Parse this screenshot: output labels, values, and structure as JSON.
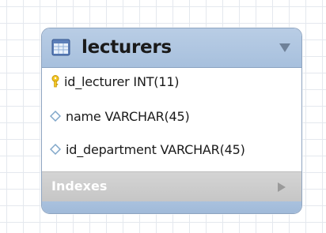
{
  "table": {
    "title": "lecturers",
    "columns": [
      {
        "label": "id_lecturer INT(11)",
        "icon": "primary-key-icon"
      },
      {
        "label": "name VARCHAR(45)",
        "icon": "column-diamond-icon"
      },
      {
        "label": "id_department VARCHAR(45)",
        "icon": "column-diamond-icon"
      }
    ],
    "indexes_label": "Indexes"
  },
  "colors": {
    "header_bg": "#a7c0dd",
    "indexes_bg": "#c6c6c6",
    "key_icon": "#f0c419",
    "diamond_icon": "#8fb1cf"
  }
}
